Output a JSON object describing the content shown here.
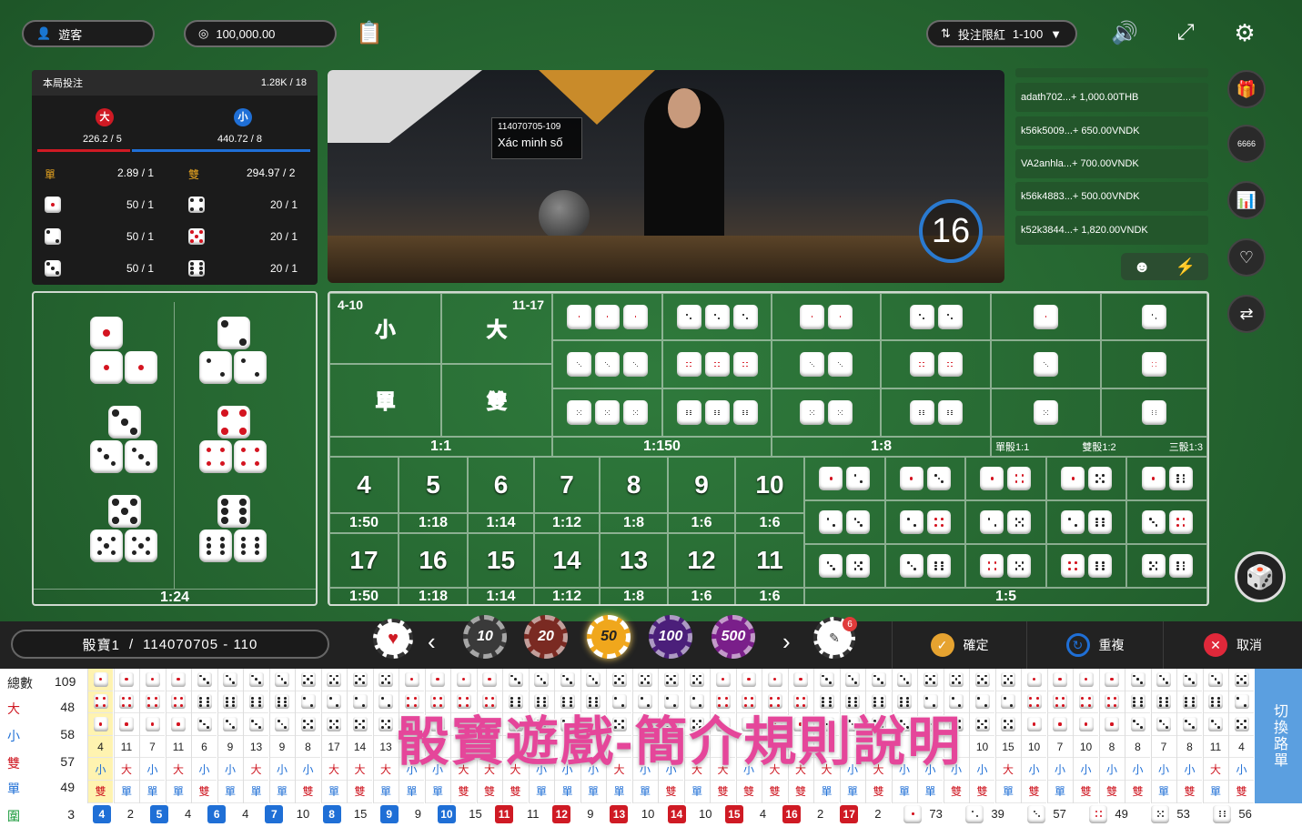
{
  "header": {
    "user_label": "遊客",
    "balance": "100,000.00",
    "limit_label": "投注限紅",
    "limit_value": "1-100"
  },
  "stats": {
    "title": "本局投注",
    "total": "1.28K / 18",
    "big_char": "大",
    "small_char": "小",
    "big_val": "226.2 / 5",
    "small_val": "440.72 / 8",
    "odd_label": "單",
    "odd_val": "2.89 / 1",
    "even_label": "雙",
    "even_val": "294.97 / 2",
    "rows": [
      {
        "left": "50 / 1",
        "right": "20 / 1"
      },
      {
        "left": "50 / 1",
        "right": "20 / 1"
      },
      {
        "left": "50 / 1",
        "right": "20 / 1"
      }
    ]
  },
  "video": {
    "round_overlay": "114070705-109",
    "overlay_text": "Xác minh số",
    "countdown": "16"
  },
  "feed": [
    "adath702...+ 1,000.00THB",
    "k56k5009...+ 650.00VNDK",
    "VA2anhla...+ 700.00VNDK",
    "k56k4883...+ 500.00VNDK",
    "k52k3844...+ 1,820.00VNDK"
  ],
  "side_icons": [
    "gift-icon",
    "dice-history-icon",
    "video-camera-icon",
    "favorite-icon",
    "switch-table-icon"
  ],
  "board": {
    "left_odds": "1:24",
    "small_range": "4-10",
    "small": "小",
    "big_range": "11-17",
    "big": "大",
    "odd": "單",
    "even": "雙",
    "bsoe_odds": "1:1",
    "triple_odds": "1:150",
    "double_odds": "1:8",
    "single_odds": [
      "單骰1:1",
      "雙骰1:2",
      "三骰1:3"
    ],
    "sums_top": [
      {
        "n": "4",
        "o": "1:50"
      },
      {
        "n": "5",
        "o": "1:18"
      },
      {
        "n": "6",
        "o": "1:14"
      },
      {
        "n": "7",
        "o": "1:12"
      },
      {
        "n": "8",
        "o": "1:8"
      },
      {
        "n": "9",
        "o": "1:6"
      },
      {
        "n": "10",
        "o": "1:6"
      }
    ],
    "sums_bottom": [
      {
        "n": "17",
        "o": "1:50"
      },
      {
        "n": "16",
        "o": "1:18"
      },
      {
        "n": "15",
        "o": "1:14"
      },
      {
        "n": "14",
        "o": "1:12"
      },
      {
        "n": "13",
        "o": "1:8"
      },
      {
        "n": "12",
        "o": "1:6"
      },
      {
        "n": "11",
        "o": "1:6"
      }
    ],
    "pair_odds": "1:5"
  },
  "controls": {
    "table_label": "骰寶1",
    "round": "114070705 - 110",
    "chips": [
      "10",
      "20",
      "50",
      "100",
      "500"
    ],
    "chip_badge": "6",
    "confirm": "確定",
    "repeat": "重複",
    "cancel": "取消"
  },
  "road": {
    "stats": [
      {
        "label": "總數",
        "value": "109"
      },
      {
        "label": "大",
        "value": "48"
      },
      {
        "label": "小",
        "value": "58"
      },
      {
        "label": "雙",
        "value": "57"
      },
      {
        "label": "單",
        "value": "49"
      },
      {
        "label": "圍",
        "value": "3"
      }
    ],
    "sums": [
      "4",
      "11",
      "7",
      "11",
      "6",
      "9",
      "13",
      "9",
      "8",
      "17",
      "14",
      "13",
      "",
      "",
      "",
      "",
      "",
      "",
      "",
      "",
      "",
      "",
      "",
      "",
      "",
      "",
      "",
      "",
      "",
      "",
      "",
      "",
      "",
      "",
      "10",
      "15",
      "10",
      "7",
      "10",
      "8",
      "8",
      "7",
      "8",
      "11",
      "4"
    ],
    "big_small": [
      "小",
      "大",
      "小",
      "大",
      "小",
      "小",
      "大",
      "小",
      "小",
      "大",
      "大",
      "大",
      "小",
      "小",
      "大",
      "大",
      "大",
      "小",
      "小",
      "小",
      "大",
      "小",
      "小",
      "大",
      "大",
      "小",
      "大",
      "大",
      "大",
      "小",
      "大",
      "小",
      "小",
      "小",
      "小",
      "大",
      "小",
      "小",
      "小",
      "小",
      "小",
      "小",
      "小",
      "大",
      "小"
    ],
    "odd_even": [
      "雙",
      "單",
      "單",
      "單",
      "雙",
      "單",
      "單",
      "單",
      "雙",
      "單",
      "雙",
      "單",
      "單",
      "單",
      "雙",
      "雙",
      "雙",
      "單",
      "單",
      "單",
      "單",
      "單",
      "雙",
      "單",
      "雙",
      "雙",
      "雙",
      "雙",
      "單",
      "單",
      "雙",
      "單",
      "單",
      "雙",
      "雙",
      "單",
      "雙",
      "單",
      "雙",
      "雙",
      "雙",
      "單",
      "雙",
      "單",
      "雙"
    ],
    "switch_label": "切換路單",
    "bottom": [
      {
        "n": "4",
        "c": "#1f6fd6"
      },
      {
        "t": "2"
      },
      {
        "n": "5",
        "c": "#1f6fd6"
      },
      {
        "t": "4"
      },
      {
        "n": "6",
        "c": "#1f6fd6"
      },
      {
        "t": "4"
      },
      {
        "n": "7",
        "c": "#1f6fd6"
      },
      {
        "t": "10"
      },
      {
        "n": "8",
        "c": "#1f6fd6"
      },
      {
        "t": "15"
      },
      {
        "n": "9",
        "c": "#1f6fd6"
      },
      {
        "t": "9"
      },
      {
        "n": "10",
        "c": "#1f6fd6"
      },
      {
        "t": "15"
      },
      {
        "n": "11",
        "c": "#cf1a24"
      },
      {
        "t": "11"
      },
      {
        "n": "12",
        "c": "#cf1a24"
      },
      {
        "t": "9"
      },
      {
        "n": "13",
        "c": "#cf1a24"
      },
      {
        "t": "10"
      },
      {
        "n": "14",
        "c": "#cf1a24"
      },
      {
        "t": "10"
      },
      {
        "n": "15",
        "c": "#cf1a24"
      },
      {
        "t": "4"
      },
      {
        "n": "16",
        "c": "#cf1a24"
      },
      {
        "t": "2"
      },
      {
        "n": "17",
        "c": "#cf1a24"
      },
      {
        "t": "2"
      }
    ],
    "face_counts": [
      "73",
      "39",
      "57",
      "49",
      "53",
      "56"
    ]
  },
  "banner": "骰寶遊戲-簡介規則說明",
  "colors": {
    "felt": "#2a6e35",
    "big_red": "#cf1a24",
    "small_blue": "#1f6fd6",
    "banner_pink": "#e5469a"
  }
}
